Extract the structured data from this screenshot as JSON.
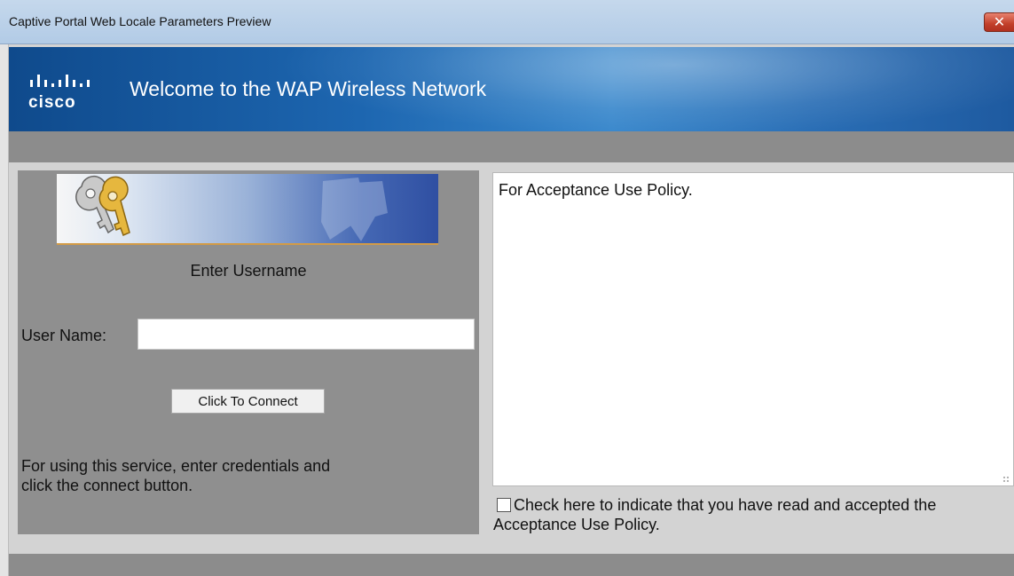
{
  "window": {
    "title": "Captive Portal Web Locale Parameters Preview",
    "close_icon": "close-icon"
  },
  "banner": {
    "logo_text": "cisco",
    "title": "Welcome to the WAP Wireless Network"
  },
  "login": {
    "heading": "Enter Username",
    "username_label": "User Name:",
    "username_value": "",
    "connect_button": "Click To Connect",
    "instructions": "For using this service, enter credentials and click the connect button."
  },
  "policy": {
    "text": "For Acceptance Use Policy.",
    "accept_label": "Check here to indicate that you have read and accepted the Acceptance Use Policy.",
    "accepted": false
  },
  "colors": {
    "banner_blue": "#1d66b0",
    "panel_gray": "#8f8f8f",
    "bar_gray": "#8c8c8c"
  }
}
